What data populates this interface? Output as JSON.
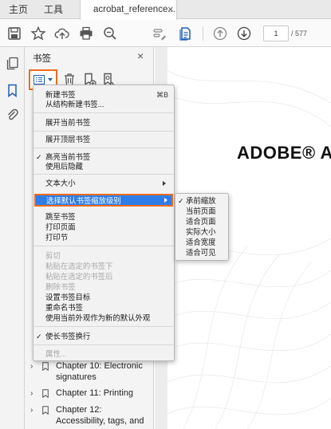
{
  "tabbar": {
    "home": "主页",
    "tools": "工具",
    "document_tab": "acrobat_reference...",
    "close_glyph": "×"
  },
  "toolbar": {
    "icons": [
      "save-icon",
      "bookmark-star-icon",
      "cloud-upload-icon",
      "print-icon",
      "search-zoom-icon",
      "edit-tool-icon",
      "page-view-icon",
      "page-up-icon",
      "page-down-icon"
    ],
    "page_current": "1",
    "page_total": "/ 577"
  },
  "rail": {
    "icons": [
      "pages-icon",
      "bookmark-icon",
      "attachment-icon"
    ]
  },
  "panel": {
    "title": "书签",
    "close_glyph": "×",
    "tool_icons": [
      "options-menu-icon",
      "delete-icon",
      "new-bookmark-icon",
      "find-bookmark-icon"
    ],
    "bookmarks": [
      {
        "label": "Chapter 10: Electronic signatures",
        "chevron": "›"
      },
      {
        "label": "Chapter 11: Printing",
        "chevron": "›"
      },
      {
        "label": "Chapter 12: Accessibility, tags, and",
        "chevron": "›"
      }
    ]
  },
  "context_menu": {
    "items": [
      {
        "label": "新建书签",
        "shortcut": "⌘B"
      },
      {
        "label": "从结构新建书签..."
      },
      {
        "label": "展开当前书签"
      },
      {
        "label": "展开顶层书签"
      },
      {
        "label": "高亮当前书签",
        "check": "✓"
      },
      {
        "label": "使用后隐藏"
      },
      {
        "label": "文本大小"
      },
      {
        "label": "选择默认书签缩放级别"
      },
      {
        "label": "跳至书签"
      },
      {
        "label": "打印页面"
      },
      {
        "label": "打印节"
      },
      {
        "label": "剪切"
      },
      {
        "label": "粘贴在选定的书签下"
      },
      {
        "label": "粘贴在选定的书签后"
      },
      {
        "label": "删除书签"
      },
      {
        "label": "设置书签目标"
      },
      {
        "label": "重命名书签"
      },
      {
        "label": "使用当前外观作为新的默认外观"
      },
      {
        "label": "使长书签换行",
        "check": "✓"
      },
      {
        "label": "属性..."
      }
    ]
  },
  "sub_menu": {
    "items": [
      {
        "label": "承前缩放",
        "check": "✓"
      },
      {
        "label": "当前页面"
      },
      {
        "label": "适合页面"
      },
      {
        "label": "实际大小"
      },
      {
        "label": "适合宽度"
      },
      {
        "label": "适合可见"
      }
    ]
  },
  "document": {
    "title": "ADOBE® AC"
  },
  "colors": {
    "highlight": "#2f7de8",
    "callout_orange": "#ef6c1c",
    "icon_blue": "#1e5fb7"
  }
}
